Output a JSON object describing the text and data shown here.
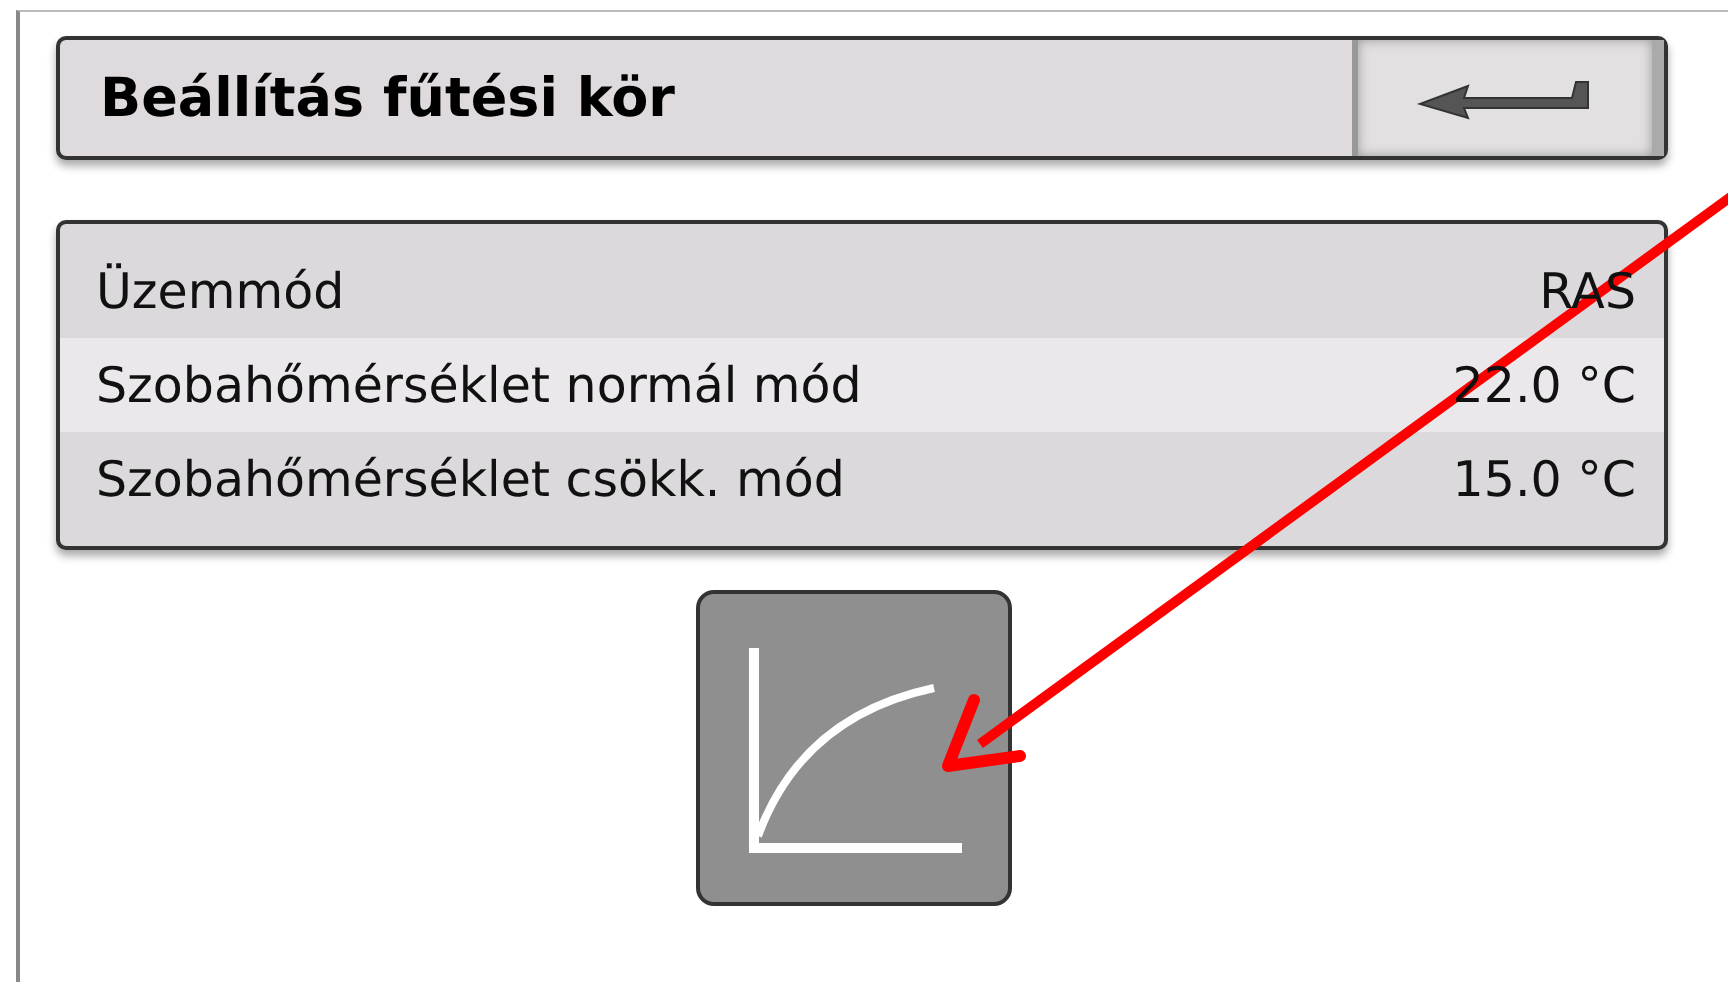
{
  "header": {
    "title": "Beállítás fűtési kör"
  },
  "settings": [
    {
      "label": "Üzemmód",
      "value": "RAS"
    },
    {
      "label": "Szobahőmérséklet normál mód",
      "value": "22.0 °C"
    },
    {
      "label": "Szobahőmérséklet csökk. mód",
      "value": "15.0 °C"
    }
  ]
}
